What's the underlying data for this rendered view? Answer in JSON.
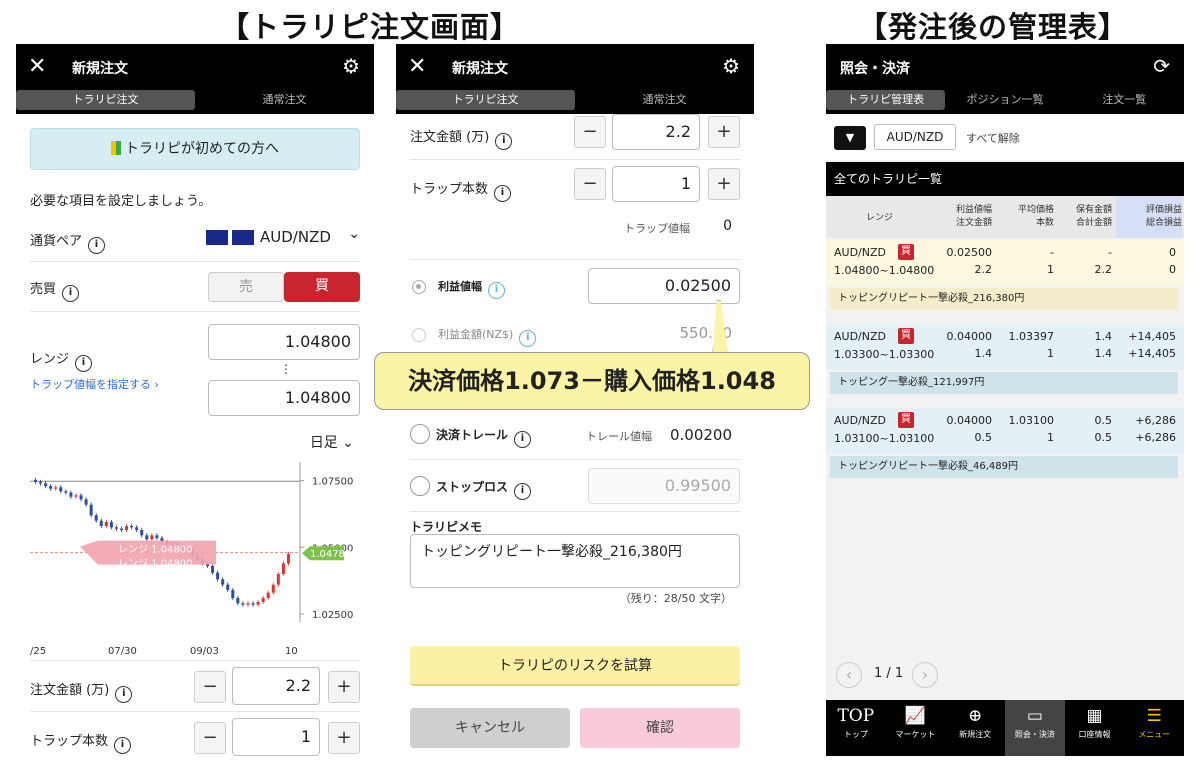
{
  "headings": {
    "left": "【トラリピ注文画面】",
    "right": "【発注後の管理表】"
  },
  "panel1": {
    "close": "✕",
    "title": "新規注文",
    "gear": "⚙",
    "tabs": [
      "トラリピ注文",
      "通常注文"
    ],
    "beginner_btn": "トラリピが初めての方へ",
    "intro": "必要な項目を設定しましょう。",
    "pair_label": "通貨ペア",
    "pair_value": "AUD/NZD",
    "side_label": "売買",
    "sell": "売",
    "buy": "買",
    "range_label": "レンジ",
    "range_high": "1.04800",
    "range_low": "1.04800",
    "range_sep": "⋮",
    "trap_link": "トラップ値幅を指定する ›",
    "period": "日足 ⌄",
    "amount_label": "注文金額 (万)",
    "amount_value": "2.2",
    "trap_count_label": "トラップ本数",
    "trap_count_value": "1"
  },
  "chart_data": {
    "type": "candlestick",
    "x_ticks": [
      "/25",
      "07/30",
      "09/03",
      "10"
    ],
    "y_ticks": [
      "1.07500",
      "1.05000",
      "1.02500"
    ],
    "ylim": [
      1.022,
      1.082
    ],
    "current_price": "1.04783",
    "range_labels": [
      "レンジ 1.04800",
      "レンジ 1.04800"
    ],
    "closes": [
      1.0745,
      1.074,
      1.073,
      1.072,
      1.0725,
      1.071,
      1.0705,
      1.069,
      1.0695,
      1.068,
      1.066,
      1.062,
      1.06,
      1.058,
      1.0595,
      1.0575,
      1.057,
      1.0565,
      1.058,
      1.0575,
      1.0565,
      1.0545,
      1.053,
      1.0545,
      1.0535,
      1.052,
      1.051,
      1.0515,
      1.05,
      1.0495,
      1.049,
      1.047,
      1.0455,
      1.044,
      1.043,
      1.0405,
      1.038,
      1.036,
      1.034,
      1.031,
      1.029,
      1.0285,
      1.029,
      1.0285,
      1.0295,
      1.031,
      1.033,
      1.036,
      1.04,
      1.044,
      1.0475
    ]
  },
  "panel2": {
    "close": "✕",
    "title": "新規注文",
    "gear": "⚙",
    "tabs": [
      "トラリピ注文",
      "通常注文"
    ],
    "amount_label": "注文金額 (万)",
    "amount_value": "2.2",
    "trap_count_label": "トラップ本数",
    "trap_count_value": "1",
    "trap_width_label": "トラップ値幅",
    "trap_width_value": "0",
    "profit_width_label": "利益値幅",
    "profit_width_value": "0.02500",
    "profit_amount_label": "利益金額(NZ$)",
    "profit_amount_value": "550.00",
    "callout": "決済価格1.073－購入価格1.048",
    "trail_label": "決済トレール",
    "trail_width_label": "トレール値幅",
    "trail_width_value": "0.00200",
    "stop_label": "ストップロス",
    "stop_value": "0.99500",
    "memo_label": "トラリピメモ",
    "memo_value": "トッピングリピート一撃必殺_216,380円",
    "memo_count": "（残り：28/50 文字）",
    "risk_btn": "トラリピのリスクを試算",
    "cancel_btn": "キャンセル",
    "confirm_btn": "確認"
  },
  "panel3": {
    "title": "照会・決済",
    "refresh": "⟳",
    "tabs": [
      "トラリピ管理表",
      "ポジション一覧",
      "注文一覧"
    ],
    "filter_icon": "▼",
    "filter_pair": "AUD/NZD",
    "clear_all": "すべて解除",
    "section": "全てのトラリピ一覧",
    "col_range": "レンジ",
    "col_headers": [
      [
        "利益値幅",
        "注文金額"
      ],
      [
        "平均価格",
        "本数"
      ],
      [
        "保有金額",
        "合計金額"
      ],
      [
        "評価損益",
        "総合損益"
      ]
    ],
    "rows": [
      {
        "pair": "AUD/NZD",
        "side": "買",
        "range": "1.04800~1.04800",
        "c1": [
          "0.02500",
          "2.2"
        ],
        "c2": [
          "-",
          "1"
        ],
        "c3": [
          "-",
          "2.2"
        ],
        "c4": [
          "0",
          "0"
        ],
        "memo": "トッピングリピート一撃必殺_216,380円",
        "bg": "#fbf8df"
      },
      {
        "pair": "AUD/NZD",
        "side": "買",
        "range": "1.03300~1.03300",
        "c1": [
          "0.04000",
          "1.4"
        ],
        "c2": [
          "1.03397",
          "1"
        ],
        "c3": [
          "1.4",
          "1.4"
        ],
        "c4": [
          "+14,405",
          "+14,405"
        ],
        "memo": "トッピング一撃必殺_121,997円",
        "bg": "#e3f0f5"
      },
      {
        "pair": "AUD/NZD",
        "side": "買",
        "range": "1.03100~1.03100",
        "c1": [
          "0.04000",
          "0.5"
        ],
        "c2": [
          "1.03100",
          "1"
        ],
        "c3": [
          "0.5",
          "0.5"
        ],
        "c4": [
          "+6,286",
          "+6,286"
        ],
        "memo": "トッピングリピート一撃必殺_46,489円",
        "bg": "#e3f0f5"
      }
    ],
    "pager": "1 / 1",
    "nav": [
      {
        "icon": "TOP",
        "label": "トップ"
      },
      {
        "icon": "📈",
        "label": "マーケット"
      },
      {
        "icon": "⊕",
        "label": "新規注文"
      },
      {
        "icon": "▭",
        "label": "照会・決済"
      },
      {
        "icon": "▦",
        "label": "口座情報"
      },
      {
        "icon": "☰",
        "label": "メニュー"
      }
    ]
  }
}
